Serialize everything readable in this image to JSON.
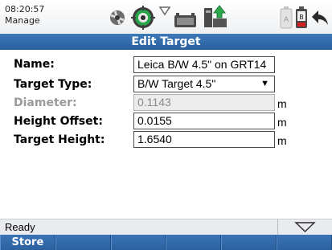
{
  "status": {
    "time": "08:20:57",
    "mode": "Manage",
    "icons": [
      "satellite-icon",
      "target-prism-icon",
      "radio-link-icon",
      "device-memory-icon",
      "data-upload-icon",
      "battery-a-icon",
      "battery-b-icon",
      "back-arrow-icon"
    ],
    "battery_b_color": "#d32020",
    "upload_arrow_color": "#2ea84a"
  },
  "title": "Edit Target",
  "form": {
    "name": {
      "label": "Name:",
      "value": "Leica B/W 4.5\" on GRT14"
    },
    "target_type": {
      "label": "Target Type:",
      "value": "B/W Target 4.5\""
    },
    "diameter": {
      "label": "Diameter:",
      "value": "0.1143",
      "unit": "m",
      "enabled": false
    },
    "height_offset": {
      "label": "Height Offset:",
      "value": "0.0155",
      "unit": "m"
    },
    "target_height": {
      "label": "Target Height:",
      "value": "1.6540",
      "unit": "m"
    }
  },
  "statusbar": {
    "text": "Ready"
  },
  "softkeys": [
    "Store",
    "",
    "",
    "",
    "",
    ""
  ],
  "colors": {
    "accent": "#2f66a8",
    "disabled_text": "#9a9a9a"
  }
}
